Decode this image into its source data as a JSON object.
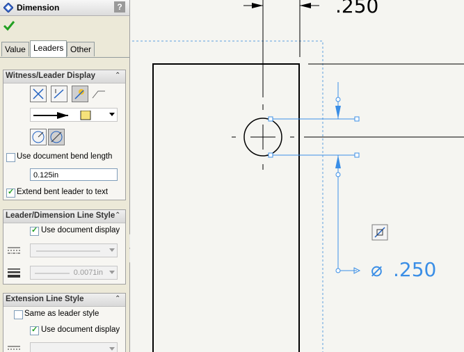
{
  "panel": {
    "title": "Dimension",
    "help": "?",
    "tabs": [
      {
        "label": "Value"
      },
      {
        "label": "Leaders"
      },
      {
        "label": "Other"
      }
    ],
    "groups": {
      "witness": {
        "title": "Witness/Leader Display",
        "use_bend_label": "Use document bend length",
        "bend_value": "0.125in",
        "extend_label": "Extend bent leader to text"
      },
      "linestyle": {
        "title": "Leader/Dimension Line Style",
        "use_doc_label": "Use document display",
        "thickness_value": "0.0071in"
      },
      "extension": {
        "title": "Extension Line Style",
        "same_as_label": "Same as leader style",
        "use_doc_label": "Use document display"
      }
    }
  },
  "drawing": {
    "top_dimension": ".250",
    "diameter_symbol": "⌀",
    "diameter_value": ".250"
  },
  "colors": {
    "accent": "#3a8ee6",
    "selection": "#5aa0e0"
  }
}
